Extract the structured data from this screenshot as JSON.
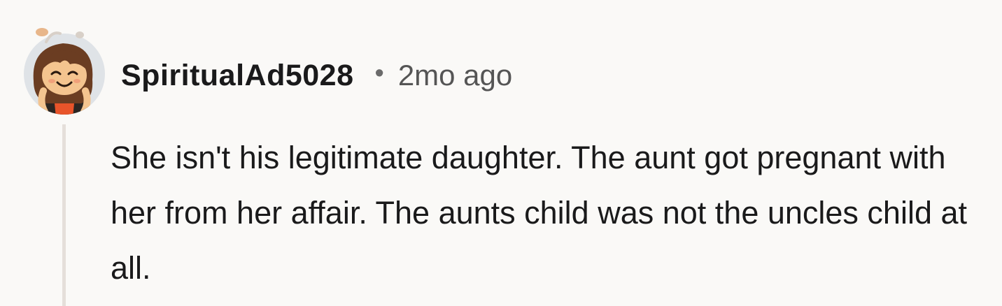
{
  "comment": {
    "username": "SpiritualAd5028",
    "separator": "•",
    "timestamp": "2mo ago",
    "avatar_icon": "user-avatar-icon",
    "body": "She isn't his legitimate daughter. The aunt got pregnant with her from her affair. The aunts child was not the uncles child at all."
  },
  "colors": {
    "background": "#faf9f7",
    "text": "#1a1a1b",
    "meta": "#555555",
    "thread_line": "#e5dfda"
  }
}
